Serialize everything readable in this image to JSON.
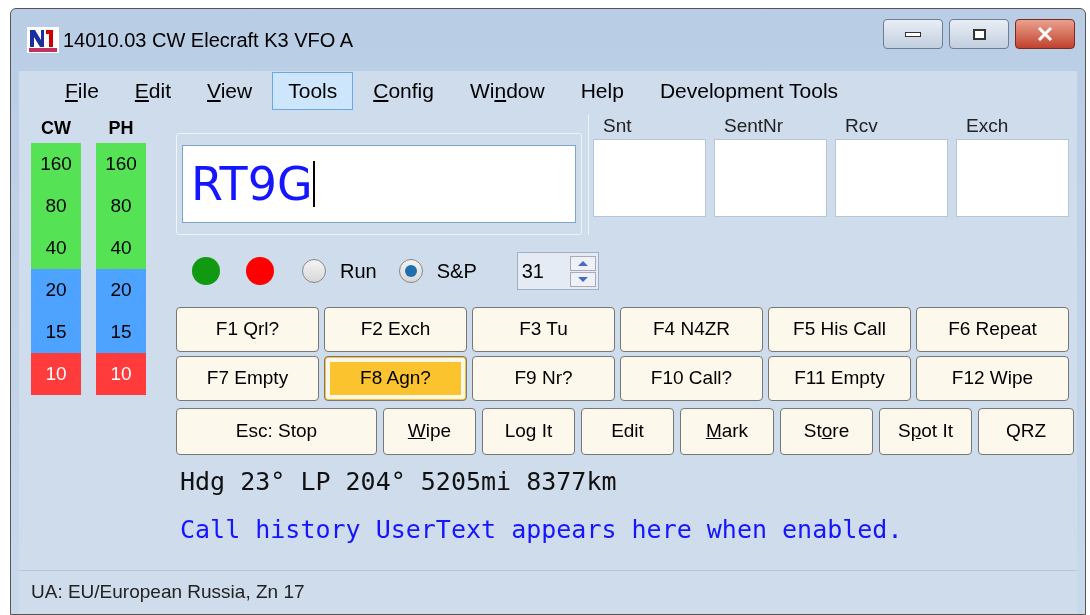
{
  "window": {
    "title": "14010.03 CW Elecraft K3 VFO A"
  },
  "menu": [
    {
      "label": [
        {
          "text": "F",
          "underline": true
        },
        {
          "text": "ile",
          "underline": false
        }
      ],
      "selected": false
    },
    {
      "label": [
        {
          "text": "E",
          "underline": true
        },
        {
          "text": "dit",
          "underline": false
        }
      ],
      "selected": false
    },
    {
      "label": [
        {
          "text": "V",
          "underline": true
        },
        {
          "text": "iew",
          "underline": false
        }
      ],
      "selected": false
    },
    {
      "label": [
        {
          "text": "Tools",
          "underline": false
        }
      ],
      "selected": true
    },
    {
      "label": [
        {
          "text": "C",
          "underline": true
        },
        {
          "text": "onfig",
          "underline": false
        }
      ],
      "selected": false
    },
    {
      "label": [
        {
          "text": "Wi",
          "underline": false
        },
        {
          "text": "n",
          "underline": true
        },
        {
          "text": "dow",
          "underline": false
        }
      ],
      "selected": false
    },
    {
      "label": [
        {
          "text": "Help",
          "underline": false
        }
      ],
      "selected": false
    },
    {
      "label": [
        {
          "text": "Development Tools",
          "underline": false
        }
      ],
      "selected": false
    }
  ],
  "bands": [
    {
      "header": "CW",
      "items": [
        {
          "label": "160",
          "color": "#55e355"
        },
        {
          "label": "80",
          "color": "#55e355"
        },
        {
          "label": "40",
          "color": "#55e355"
        },
        {
          "label": "20",
          "color": "#4da3ff"
        },
        {
          "label": "15",
          "color": "#4da3ff"
        },
        {
          "label": "10",
          "color": "#ff3b3b"
        }
      ]
    },
    {
      "header": "PH",
      "items": [
        {
          "label": "160",
          "color": "#55e355"
        },
        {
          "label": "80",
          "color": "#55e355"
        },
        {
          "label": "40",
          "color": "#55e355"
        },
        {
          "label": "20",
          "color": "#4da3ff"
        },
        {
          "label": "15",
          "color": "#4da3ff"
        },
        {
          "label": "10",
          "color": "#ff3b3b"
        }
      ]
    }
  ],
  "call_field": {
    "value": "RT9G"
  },
  "exchange_fields": [
    {
      "label": "Snt"
    },
    {
      "label": "SentNr"
    },
    {
      "label": "Rcv"
    },
    {
      "label": "Exch"
    }
  ],
  "indicators": [
    {
      "color": "#119911"
    },
    {
      "color": "#ff0000"
    }
  ],
  "modes": [
    {
      "label": "Run",
      "selected": false
    },
    {
      "label": "S&P",
      "selected": true
    }
  ],
  "spinner": {
    "value": "31"
  },
  "function_keys": [
    {
      "label": "F1 Qrl?",
      "selected": false
    },
    {
      "label": "F2 Exch",
      "selected": false
    },
    {
      "label": "F3 Tu",
      "selected": false
    },
    {
      "label": "F4 N4ZR",
      "selected": false
    },
    {
      "label": "F5 His Call",
      "selected": false
    },
    {
      "label": "F6 Repeat",
      "selected": false
    },
    {
      "label": "F7 Empty",
      "selected": false
    },
    {
      "label": "F8 Agn?",
      "selected": true
    },
    {
      "label": "F9 Nr?",
      "selected": false
    },
    {
      "label": "F10 Call?",
      "selected": false
    },
    {
      "label": "F11 Empty",
      "selected": false
    },
    {
      "label": "F12 Wipe",
      "selected": false
    }
  ],
  "action_buttons": [
    {
      "label": [
        {
          "text": "Esc: Stop",
          "underline": false
        }
      ]
    },
    {
      "label": [
        {
          "text": "W",
          "underline": true
        },
        {
          "text": "ipe",
          "underline": false
        }
      ]
    },
    {
      "label": [
        {
          "text": "Log It",
          "underline": false
        }
      ]
    },
    {
      "label": [
        {
          "text": "Edit",
          "underline": false
        }
      ]
    },
    {
      "label": [
        {
          "text": "M",
          "underline": true
        },
        {
          "text": "ark",
          "underline": false
        }
      ]
    },
    {
      "label": [
        {
          "text": "St",
          "underline": false
        },
        {
          "text": "o",
          "underline": true
        },
        {
          "text": "re",
          "underline": false
        }
      ]
    },
    {
      "label": [
        {
          "text": "S",
          "underline": false
        },
        {
          "text": "p",
          "underline": true
        },
        {
          "text": "ot It",
          "underline": false
        }
      ]
    },
    {
      "label": [
        {
          "text": "QRZ",
          "underline": false
        }
      ]
    }
  ],
  "bearing": "Hdg 23° LP 204° 5205mi 8377km",
  "user_text": "Call history UserText appears here when enabled.",
  "status_bar": "UA: EU/European Russia, Zn 17"
}
